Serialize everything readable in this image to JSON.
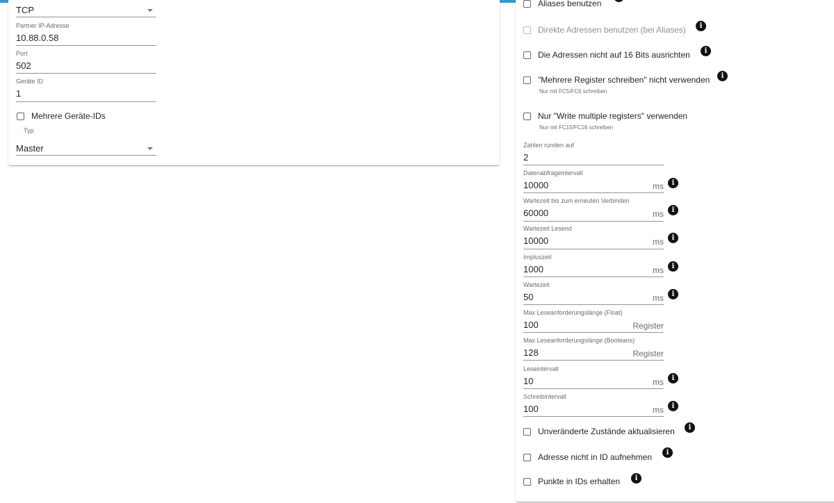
{
  "left": {
    "protocol": {
      "value": "TCP"
    },
    "partner_ip": {
      "label": "Partner IP-Adresse",
      "value": "10.88.0.58"
    },
    "port": {
      "label": "Port",
      "value": "502"
    },
    "device_id": {
      "label": "Geräte ID",
      "value": "1"
    },
    "multi_ids": {
      "label": "Mehrere Geräte-IDs",
      "checked": false
    },
    "type": {
      "label": "Typ",
      "value": "Master"
    }
  },
  "right": {
    "checkboxes": {
      "aliases": {
        "label": "Aliases benutzen",
        "checked": false
      },
      "direct": {
        "label": "Direkte Adressen benutzen (bei Aliases)",
        "checked": false
      },
      "align16": {
        "label": "Die Adressen nicht auf 16 Bits ausrichten",
        "checked": false
      },
      "multi_write": {
        "label": "\"Mehrere Register schreiben\" nicht verwenden",
        "helper": "Nur mit FC5/FC6 schreiben",
        "checked": false
      },
      "only_multi": {
        "label": "Nur \"Write multiple registers\" verwenden",
        "helper": "Nur mit FC15/FC16 schreiben",
        "checked": false
      },
      "unchanged": {
        "label": "Unveränderte Zustände aktualisieren",
        "checked": false
      },
      "addr_not_in_id": {
        "label": "Adresse nicht in ID aufnehmen",
        "checked": false
      },
      "keep_dots": {
        "label": "Punkte in IDs erhalten",
        "checked": false
      }
    },
    "fields": {
      "round": {
        "label": "Zahlen runden auf",
        "value": "2"
      },
      "poll": {
        "label": "Datenabfrageintervall",
        "value": "10000",
        "unit": "ms"
      },
      "reconnect": {
        "label": "Wartezeit bis zum erneuten Verbinden",
        "value": "60000",
        "unit": "ms"
      },
      "read_timeout": {
        "label": "Wartezeit Lesend",
        "value": "10000",
        "unit": "ms"
      },
      "pulse": {
        "label": "Impluszeit",
        "value": "1000",
        "unit": "ms"
      },
      "wait": {
        "label": "Wartezeit",
        "value": "50",
        "unit": "ms"
      },
      "max_float": {
        "label": "Max Leseanforderungslänge (Float)",
        "value": "100",
        "unit": "Register"
      },
      "max_bool": {
        "label": "Max Leseanforderungslänge (Booleans)",
        "value": "128",
        "unit": "Register"
      },
      "read_interval": {
        "label": "Leseintervall",
        "value": "10",
        "unit": "ms"
      },
      "write_interval": {
        "label": "Schreibintervall",
        "value": "100",
        "unit": "ms"
      }
    }
  },
  "icons": {
    "info": "i"
  },
  "colors": {
    "accent": "#3399cc",
    "info_icon": "#111111"
  }
}
